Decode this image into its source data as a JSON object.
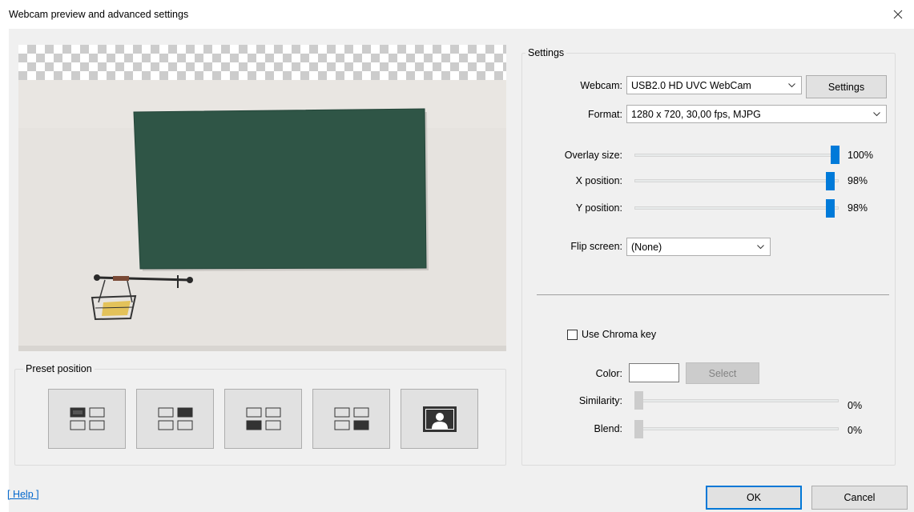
{
  "window": {
    "title": "Webcam preview and advanced settings"
  },
  "preset_group": {
    "label": "Preset position",
    "buttons": [
      {
        "name": "top-left"
      },
      {
        "name": "top-right"
      },
      {
        "name": "bottom-left"
      },
      {
        "name": "bottom-right"
      },
      {
        "name": "fullscreen"
      }
    ]
  },
  "settings": {
    "group_label": "Settings",
    "webcam_label": "Webcam:",
    "webcam_value": "USB2.0 HD UVC WebCam",
    "settings_button": "Settings",
    "format_label": "Format:",
    "format_value": "1280 x 720, 30,00 fps, MJPG",
    "overlay_size_label": "Overlay size:",
    "overlay_size_value": "100%",
    "overlay_size_level": 1.0,
    "x_position_label": "X position:",
    "x_position_value": "98%",
    "x_position_level": 0.98,
    "y_position_label": "Y position:",
    "y_position_value": "98%",
    "y_position_level": 0.98,
    "flip_label": "Flip screen:",
    "flip_value": "(None)"
  },
  "chroma": {
    "checkbox_label": "Use Chroma key",
    "checked": false,
    "color_label": "Color:",
    "select_button": "Select",
    "similarity_label": "Similarity:",
    "similarity_value": "0%",
    "similarity_level": 0,
    "blend_label": "Blend:",
    "blend_value": "0%",
    "blend_level": 0
  },
  "footer": {
    "help_link": "[ Help ]",
    "ok_button": "OK",
    "cancel_button": "Cancel"
  },
  "colors": {
    "accent": "#0078d7",
    "slider_thumb": "#007ad9",
    "link": "#0066cc",
    "dialog_bg": "#f0f0f0",
    "blackboard": "#2f5546"
  }
}
